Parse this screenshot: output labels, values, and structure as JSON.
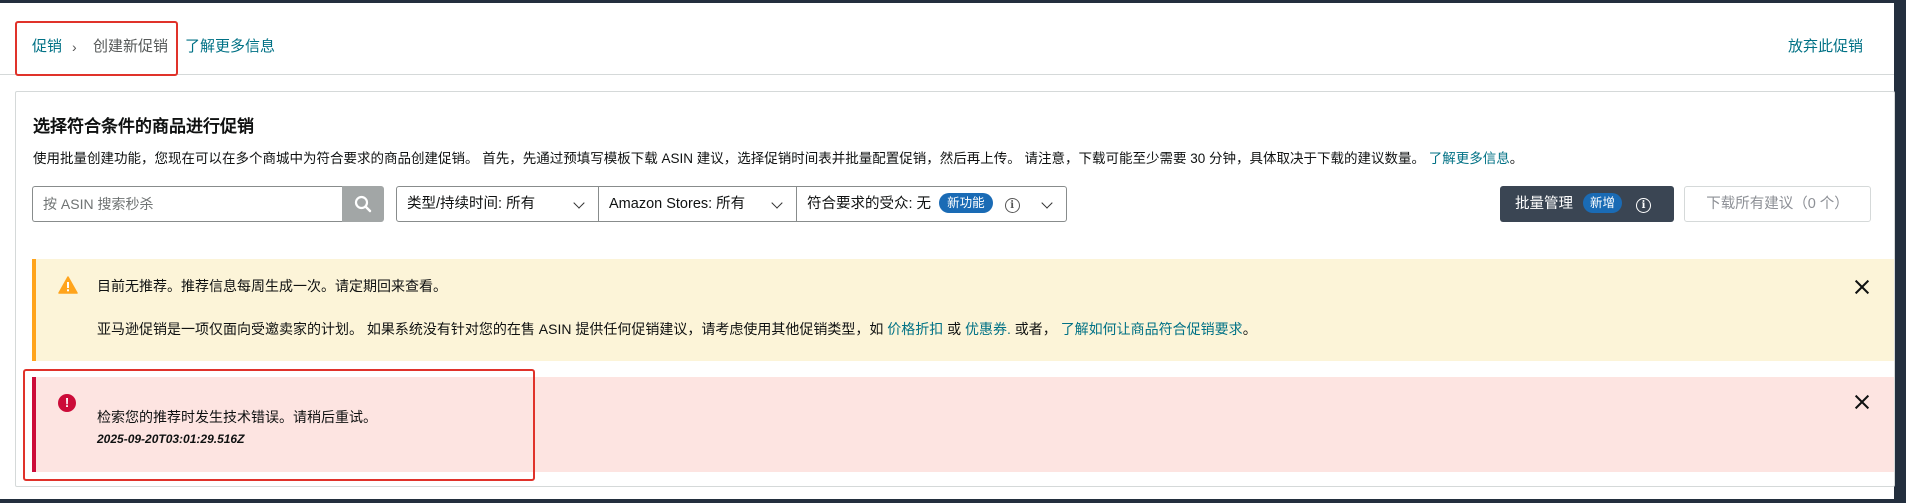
{
  "header": {
    "breadcrumb": {
      "parent": "促销",
      "separator": "›",
      "current": "创建新促销"
    },
    "learn_more": "了解更多信息",
    "abandon": "放弃此促销"
  },
  "card": {
    "title": "选择符合条件的商品进行促销",
    "description": "使用批量创建功能，您现在可以在多个商城中为符合要求的商品创建促销。 首先，先通过预填写模板下载 ASIN 建议，选择促销时间表并批量配置促销，然后再上传。 请注意，下载可能至少需要 30 分钟，具体取决于下载的建议数量。",
    "description_link": "了解更多信息",
    "description_end": "。"
  },
  "toolbar": {
    "search_placeholder": "按 ASIN 搜索秒杀",
    "filter_type": "类型/持续时间:  所有",
    "filter_stores": "Amazon Stores: 所有",
    "filter_audience": "符合要求的受众: 无",
    "audience_badge": "新功能",
    "bulk_manage": "批量管理",
    "bulk_badge": "新增",
    "download_all": "下载所有建议（0 个）"
  },
  "alerts": {
    "warning": {
      "line1": "目前无推荐。推荐信息每周生成一次。请定期回来查看。",
      "line2_prefix": "亚马逊促销是一项仅面向受邀卖家的计划。 如果系统没有针对您的在售 ASIN 提供任何促销建议，请考虑使用其他促销类型，如",
      "link_price": "价格折扣",
      "or": "或",
      "link_coupon": "优惠券.",
      "or_else": "或者，",
      "link_learn": "了解如何让商品符合促销要求",
      "end": "。"
    },
    "error": {
      "message": "检索您的推荐时发生技术错误。请稍后重试。",
      "timestamp": "2025-09-20T03:01:29.516Z"
    }
  },
  "colors": {
    "link": "#007185",
    "warning_bg": "#fcf4d8",
    "warning_border": "#ffa41c",
    "error_bg": "#fde4e1",
    "error_border": "#cc0c39",
    "highlight_box": "#e0322a",
    "badge_blue": "#1a6bb5",
    "dark_button": "#3a4553"
  }
}
